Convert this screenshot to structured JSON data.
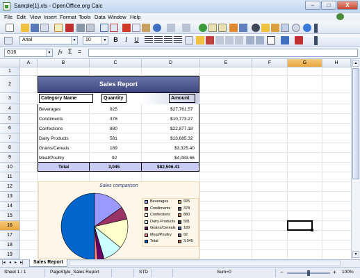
{
  "window": {
    "title": "Sample[1].xls - OpenOffice.org Calc",
    "minimize": "–",
    "maximize": "□",
    "close": "X"
  },
  "menu": [
    "File",
    "Edit",
    "View",
    "Insert",
    "Format",
    "Tools",
    "Data",
    "Window",
    "Help"
  ],
  "toolbar": {
    "font_name": "Arial",
    "font_size": "10",
    "bold": "B",
    "italic": "I",
    "underline": "U"
  },
  "formula": {
    "cell_ref": "G16",
    "fx": "fx",
    "sum": "Σ",
    "equals": "=",
    "content": ""
  },
  "columns": [
    "A",
    "B",
    "C",
    "D",
    "E",
    "F",
    "G",
    "H"
  ],
  "rows": [
    "1",
    "2",
    "3",
    "4",
    "5",
    "6",
    "7",
    "8",
    "9",
    "10",
    "11",
    "12",
    "13",
    "14",
    "15",
    "16",
    "17",
    "18",
    "19"
  ],
  "selected": {
    "column": "G",
    "row": "16"
  },
  "report": {
    "title": "Sales Report",
    "headers": [
      "Category Name",
      "Quantity",
      "Amount"
    ],
    "rows": [
      {
        "category": "Beverages",
        "quantity": "925",
        "amount": "$27,761.57"
      },
      {
        "category": "Condiments",
        "quantity": "378",
        "amount": "$10,773.27"
      },
      {
        "category": "Confections",
        "quantity": "880",
        "amount": "$22,877.18"
      },
      {
        "category": "Dairy Products",
        "quantity": "581",
        "amount": "$13,685.32"
      },
      {
        "category": "Grains/Cereals",
        "quantity": "189",
        "amount": "$3,325.40"
      },
      {
        "category": "Meat/Poultry",
        "quantity": "92",
        "amount": "$4,083.66"
      }
    ],
    "total": {
      "label": "Total",
      "quantity": "3,045",
      "amount": "$82,506.41"
    }
  },
  "chart_data": {
    "type": "pie",
    "title": "Sales comparison",
    "categories": [
      "Beverages",
      "Condiments",
      "Confections",
      "Dairy Products",
      "Grains/Cereals",
      "Meat/Poultry",
      "Total"
    ],
    "values": [
      925,
      378,
      880,
      581,
      189,
      92,
      3045
    ],
    "colors": [
      "#9999ff",
      "#993366",
      "#ffffcc",
      "#ccffff",
      "#660066",
      "#ff8080",
      "#0066cc"
    ]
  },
  "tabs": {
    "sheet": "Sales Report"
  },
  "status": {
    "sheet": "Sheet 1 / 1",
    "style": "PageStyle_Sales Report",
    "mode": "STD",
    "sum": "Sum=0",
    "zoom": "100%",
    "zoom_minus": "−",
    "zoom_plus": "+",
    "zoom_level": 0.5
  }
}
